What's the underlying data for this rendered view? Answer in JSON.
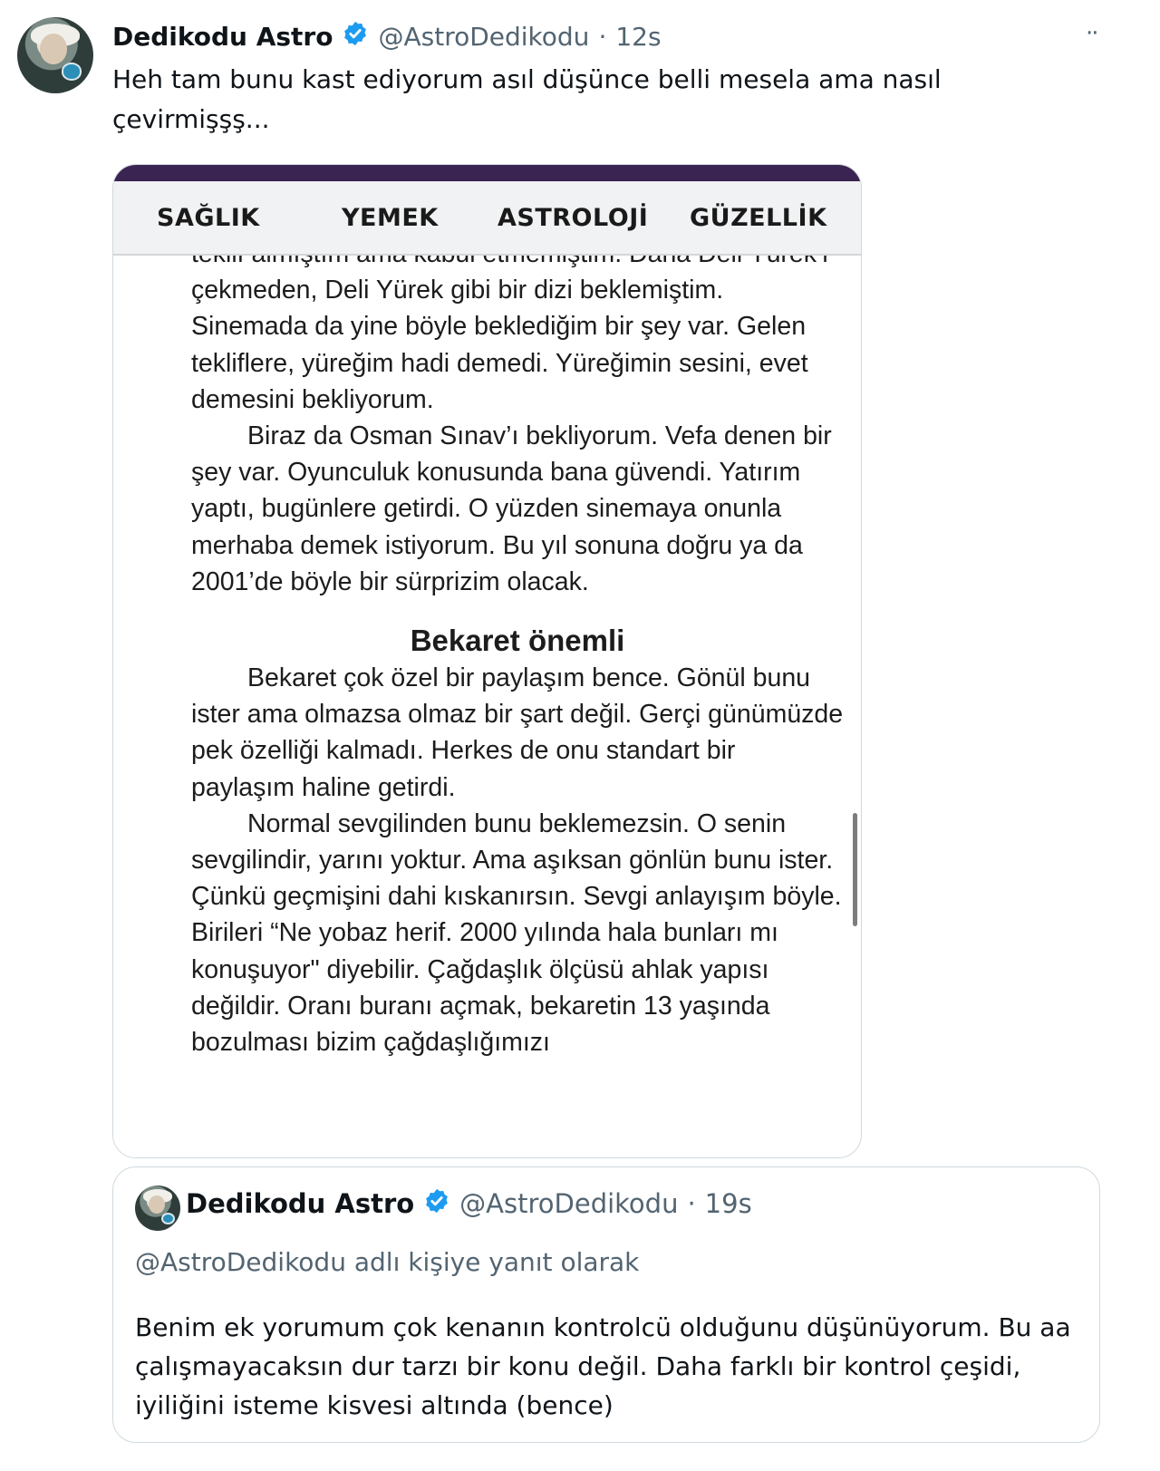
{
  "tweet": {
    "display_name": "Dedikodu Astro",
    "handle": "@AstroDedikodu",
    "separator": "·",
    "time": "12s",
    "more_label": "··",
    "text": "Heh tam bunu kast ediyorum asıl düşünce belli mesela ama nasıl çevirmişşş..."
  },
  "media": {
    "nav": [
      "SAĞLIK",
      "YEMEK",
      "ASTROLOJİ",
      "GÜZELLİK"
    ],
    "article": {
      "p1": "teklif almıştım ama kabul etmemiştim. Daha Deli Yürek’i çekmeden, Deli Yürek gibi bir dizi beklemiştim. Sinemada da yine böyle beklediğim bir şey var. Gelen tekliflere, yüreğim hadi demedi. Yüreğimin sesini, evet demesini bekliyorum.",
      "p2": "Biraz da Osman Sınav’ı bekliyorum. Vefa denen bir şey var. Oyunculuk konusunda bana güvendi. Yatırım yaptı, bugünlere getirdi. O yüzden sinemaya onunla merhaba demek istiyorum. Bu yıl sonuna doğru ya da 2001’de böyle bir sürprizim olacak.",
      "heading": "Bekaret önemli",
      "p3": "Bekaret çok özel bir paylaşım bence. Gönül bunu ister ama olmazsa olmaz bir şart değil. Gerçi günümüzde pek özelliği kalmadı. Herkes de onu standart bir paylaşım haline getirdi.",
      "p4": "Normal sevgilinden bunu beklemezsin. O senin sevgilindir, yarını yoktur. Ama aşıksan gönlün bunu ister. Çünkü geçmişini dahi kıskanırsın. Sevgi anlayışım böyle. Birileri “Ne yobaz herif. 2000 yılında hala bunları mı konuşuyor\" diyebilir. Çağdaşlık ölçüsü ahlak yapısı değildir. Oranı buranı açmak, bekaretin 13 yaşında bozulması bizim çağdaşlığımızı"
    }
  },
  "quote": {
    "display_name": "Dedikodu Astro",
    "handle": "@AstroDedikodu",
    "separator": "·",
    "time": "19s",
    "reply_to": "@AstroDedikodu adlı kişiye yanıt olarak",
    "text": "Benim ek yorumum çok kenanın kontrolcü olduğunu düşünüyorum. Bu aa çalışmayacaksın dur tarzı bir konu değil. Daha farklı bir kontrol çeşidi, iyiliğini isteme kisvesi altında (bence)"
  },
  "colors": {
    "verified": "#1d9bf0",
    "muted_text": "#536471",
    "border": "#cfd9de",
    "media_topbar": "#3a2452"
  },
  "icons": {
    "verified": "verified-badge-icon",
    "more": "more-dots-icon"
  }
}
